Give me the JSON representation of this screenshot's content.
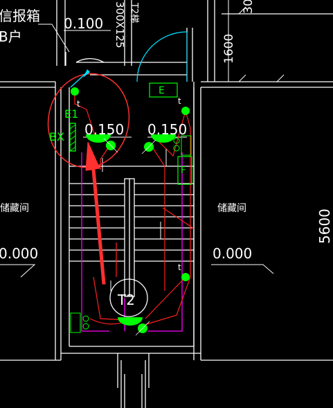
{
  "labels": {
    "top_left_line1": "信报箱",
    "top_left_line2": "B户",
    "level_top": "0.100",
    "duct_size": "300X125",
    "stair_tag": "T2梯",
    "top_right_partial": "30",
    "dim_1600": "1600",
    "dim_5600": "5600",
    "e_box": "E",
    "e1": "E1",
    "bx": "BX",
    "level_landing_left": "0.150",
    "level_landing_right": "0.150",
    "f_box": "F",
    "storage_left": "储藏间",
    "storage_right": "储藏间",
    "level_left_room": "0.000",
    "level_right_room": "0.000",
    "t2": "T2",
    "switch_mark_1": "t",
    "switch_mark_2": "t",
    "switch_mark_3": "t"
  },
  "colors": {
    "background": "#000000",
    "wall": "#ffffff",
    "green": "#00ff00",
    "red": "#ff2020",
    "magenta": "#ff00ff",
    "cyan": "#00e0ff",
    "annotation": "#ff3030"
  }
}
